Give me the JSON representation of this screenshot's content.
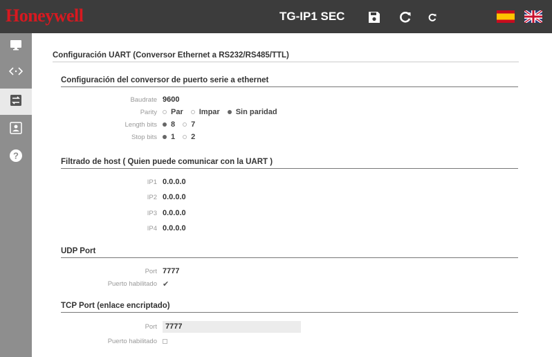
{
  "header": {
    "brand": "Honeywell",
    "title": "TG-IP1 SEC"
  },
  "icons": {
    "save": "save-icon",
    "reload": "reload-icon",
    "restart": "restart-icon",
    "flag_es": "flag-es-icon",
    "flag_uk": "flag-uk-icon"
  },
  "sidebar": {
    "items": [
      {
        "name": "monitor-icon",
        "active": false
      },
      {
        "name": "code-icon",
        "active": false
      },
      {
        "name": "transfer-icon",
        "active": true
      },
      {
        "name": "user-icon",
        "active": false
      },
      {
        "name": "help-icon",
        "active": false
      }
    ]
  },
  "main": {
    "title": "Configuración UART (Conversor Ethernet a RS232/RS485/TTL)",
    "serial": {
      "title": "Configuración del conversor de puerto serie a ethernet",
      "baudrate_label": "Baudrate",
      "baudrate_value": "9600",
      "parity_label": "Parity",
      "parity_options": [
        "Par",
        "Impar",
        "Sin paridad"
      ],
      "parity_selected": "Sin paridad",
      "length_label": "Length bits",
      "length_options": [
        "8",
        "7"
      ],
      "length_selected": "8",
      "stop_label": "Stop bits",
      "stop_options": [
        "1",
        "2"
      ],
      "stop_selected": "1"
    },
    "host_filter": {
      "title": "Filtrado de host ( Quien puede comunicar con la UART )",
      "ips": [
        {
          "label": "IP1",
          "value": "0.0.0.0"
        },
        {
          "label": "IP2",
          "value": "0.0.0.0"
        },
        {
          "label": "IP3",
          "value": "0.0.0.0"
        },
        {
          "label": "IP4",
          "value": "0.0.0.0"
        }
      ]
    },
    "udp": {
      "title": "UDP Port",
      "port_label": "Port",
      "port_value": "7777",
      "enabled_label": "Puerto habilitado",
      "enabled": true
    },
    "tcp": {
      "title": "TCP Port (enlace encriptado)",
      "port_label": "Port",
      "port_value": "7777",
      "enabled_label": "Puerto habilitado",
      "enabled": false
    }
  }
}
